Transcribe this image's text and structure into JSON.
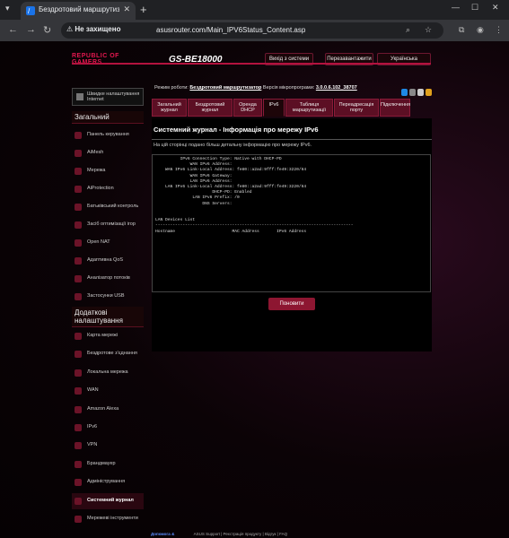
{
  "browser": {
    "tab_title": "Бездротовий маршрутизатор ASUS",
    "security_label": "Не захищено",
    "url": "asusrouter.com/Main_IPV6Status_Content.asp"
  },
  "header": {
    "logo_line1": "REPUBLIC OF",
    "logo_line2": "GAMERS",
    "model": "GS-BE18000",
    "logout": "Вихід з системи",
    "reboot": "Перезавантажити",
    "language": "Українська"
  },
  "sidebar": {
    "quick": "Швидке налаштування Internet",
    "general_title": "Загальний",
    "general_items": [
      "Панель керування",
      "AiMesh",
      "Мережа",
      "AiProtection",
      "Батьківський контроль",
      "Засіб оптимізації ігор",
      "Open NAT",
      "Адаптивна QoS",
      "Аналізатор потоків",
      "Застосунки USB"
    ],
    "advanced_title": "Додаткові налаштування",
    "advanced_items": [
      "Карта мережі",
      "Бездротове з'єднання",
      "Локальна мережа",
      "WAN",
      "Amazon Alexa",
      "IPv6",
      "VPN",
      "Брандмауер",
      "Адміністрування",
      "Системний журнал",
      "Мережеві інструменти"
    ]
  },
  "main": {
    "mode_label": "Режим роботи:",
    "mode_value": "Бездротовий маршрутизатор",
    "fw_label": "Версія мікропрограми:",
    "fw_value": "3.0.0.6.102_38707",
    "tabs": [
      "Загальний журнал",
      "Бездротовий журнал",
      "Оренда DHCP",
      "IPv6",
      "Таблиця маршрутизації",
      "Переадресація порту",
      "Підключення"
    ],
    "title": "Системний журнал - Інформація про мережу IPv6",
    "description": "На цій сторінці подано більш детальну інформацію про мережу IPv6.",
    "log": "          IPv6 Connection Type: Native with DHCP-PD\n              WAN IPv6 Address:\n    WAN IPv6 Link-Local Address: fe80::a2ad:9fff:fe49:3220/64\n              WAN IPv6 Gateway:\n              LAN IPv6 Address:\n    LAN IPv6 Link-Local Address: fe80::a2ad:9fff:fe49:3220/64\n                       DHCP-PD: Enabled\n               LAN IPv6 Prefix: /0\n                   DNS Servers:\n\n\nLAN Devices List\n--------------------------------------------------------------------------------\nHostname                       MAC Address       IPv6 Address",
    "refresh": "Поновити"
  },
  "footer": {
    "help": "Допомога &",
    "links": "ASUS Support | Реєстрація продукту | Відгук | FAQ"
  }
}
